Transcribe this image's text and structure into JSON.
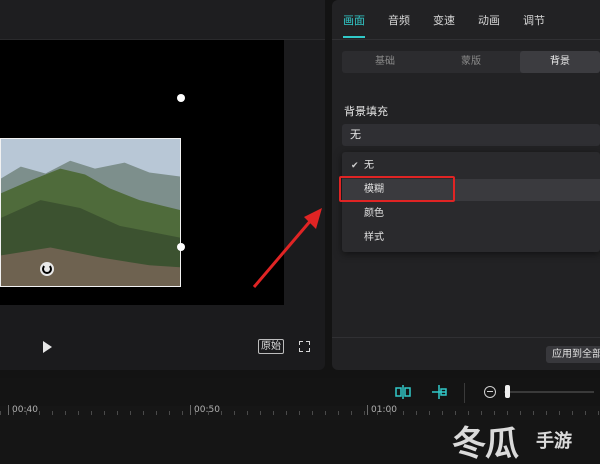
{
  "panel": {
    "tabs": [
      {
        "label": "画面",
        "active": true
      },
      {
        "label": "音频",
        "active": false
      },
      {
        "label": "变速",
        "active": false
      },
      {
        "label": "动画",
        "active": false
      },
      {
        "label": "调节",
        "active": false
      }
    ],
    "subtabs": [
      {
        "label": "基础",
        "active": false
      },
      {
        "label": "蒙版",
        "active": false
      },
      {
        "label": "背景",
        "active": true
      }
    ],
    "background_fill": {
      "label": "背景填充",
      "selected": "无",
      "options": [
        {
          "label": "无",
          "checked": true
        },
        {
          "label": "模糊",
          "checked": false,
          "highlighted": true
        },
        {
          "label": "颜色",
          "checked": false
        },
        {
          "label": "样式",
          "checked": false
        }
      ]
    },
    "apply_all_label": "应用到全部"
  },
  "player": {
    "ratio_label": "原始"
  },
  "timeline": {
    "ruler_labels": [
      "00:40",
      "00:50",
      "01:00"
    ]
  },
  "watermark": {
    "main": "冬瓜",
    "sub": "手游"
  },
  "colors": {
    "accent": "#31c9c9",
    "annotation_red": "#e02424",
    "panel_bg": "#222224"
  }
}
